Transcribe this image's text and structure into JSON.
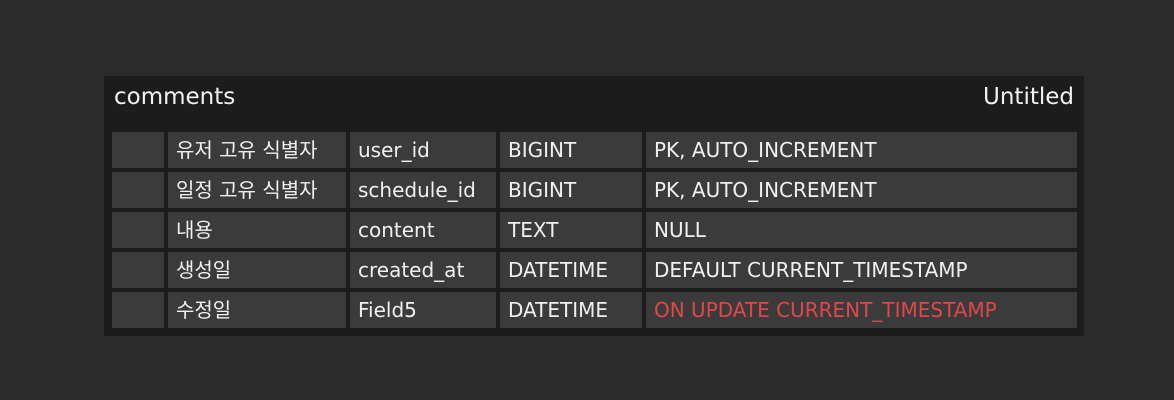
{
  "entity": {
    "name": "comments",
    "schema": "Untitled",
    "warn_color": "#e0474a",
    "columns": [
      {
        "logical": "유저 고유 식별자",
        "physical": "user_id",
        "type": "BIGINT",
        "option": "PK, AUTO_INCREMENT",
        "highlight": false
      },
      {
        "logical": "일정 고유 식별자",
        "physical": "schedule_id",
        "type": "BIGINT",
        "option": "PK, AUTO_INCREMENT",
        "highlight": false
      },
      {
        "logical": "내용",
        "physical": "content",
        "type": "TEXT",
        "option": "NULL",
        "highlight": false
      },
      {
        "logical": "생성일",
        "physical": "created_at",
        "type": "DATETIME",
        "option": "DEFAULT CURRENT_TIMESTAMP",
        "highlight": false
      },
      {
        "logical": "수정일",
        "physical": "Field5",
        "type": "DATETIME",
        "option": "ON UPDATE CURRENT_TIMESTAMP",
        "highlight": true
      }
    ]
  }
}
